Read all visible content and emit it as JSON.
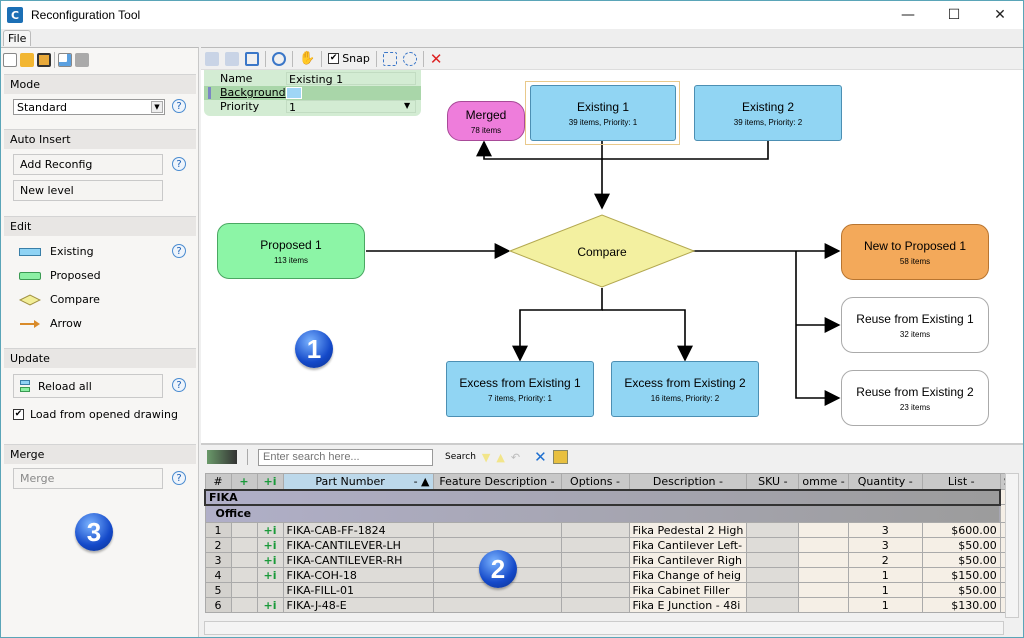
{
  "window": {
    "title": "Reconfiguration Tool",
    "minimize": "—",
    "maximize": "☐",
    "close": "✕"
  },
  "menu": {
    "file": "File"
  },
  "left_panel": {
    "mode": {
      "header": "Mode",
      "selected": "Standard"
    },
    "auto_insert": {
      "header": "Auto Insert",
      "add_reconfig": "Add Reconfig",
      "new_level": "New level"
    },
    "edit": {
      "header": "Edit",
      "tools": [
        {
          "label": "Existing",
          "icon": "existing-shape-icon",
          "color": "#8fd3f4"
        },
        {
          "label": "Proposed",
          "icon": "proposed-shape-icon",
          "color": "#8cf0a4"
        },
        {
          "label": "Compare",
          "icon": "compare-diamond-icon",
          "color": "#f2ee98"
        },
        {
          "label": "Arrow",
          "icon": "arrow-icon",
          "color": "#d98b2a"
        }
      ]
    },
    "update": {
      "header": "Update",
      "reload_all": "Reload all",
      "load_from_drawing": "Load from opened drawing",
      "load_checked": true
    },
    "merge": {
      "header": "Merge",
      "merge_button": "Merge"
    },
    "help": "?",
    "badge": "3"
  },
  "canvas_toolbar": {
    "snap_label": "Snap",
    "snap_checked": true
  },
  "properties": {
    "rows": [
      {
        "label": "Name",
        "value": "Existing 1"
      },
      {
        "label": "Background",
        "value": ""
      },
      {
        "label": "Priority",
        "value": "1"
      }
    ],
    "background_color": "#9fd6f6"
  },
  "diagram": {
    "nodes": {
      "merged": {
        "title": "Merged",
        "sub": "78 items",
        "color": "#ee7ddb"
      },
      "existing1": {
        "title": "Existing 1",
        "sub": "39 items, Priority: 1",
        "color": "#91d5f3"
      },
      "existing2": {
        "title": "Existing 2",
        "sub": "39 items, Priority: 2",
        "color": "#91d5f3"
      },
      "proposed1": {
        "title": "Proposed 1",
        "sub": "113 items",
        "color": "#8cf5a6"
      },
      "compare": {
        "title": "Compare",
        "color": "#f3f0a0"
      },
      "new_to_proposed": {
        "title": "New to Proposed 1",
        "sub": "58 items",
        "color": "#f3a95a"
      },
      "reuse1": {
        "title": "Reuse from Existing 1",
        "sub": "32 items",
        "color": "#ffffff"
      },
      "reuse2": {
        "title": "Reuse from Existing 2",
        "sub": "23 items",
        "color": "#ffffff"
      },
      "excess1": {
        "title": "Excess from Existing 1",
        "sub": "7 items, Priority: 1",
        "color": "#91d5f3"
      },
      "excess2": {
        "title": "Excess from Existing 2",
        "sub": "16 items, Priority: 2",
        "color": "#91d5f3"
      }
    },
    "badge": "1"
  },
  "grid": {
    "search_placeholder": "Enter search here...",
    "search_button": "Search",
    "columns": [
      "#",
      "+",
      "+i",
      "Part Number",
      "Feature Description",
      "Options",
      "Description",
      "SKU",
      "omme",
      "Quantity",
      "List",
      "S"
    ],
    "group": "FIKA",
    "subgroup": "Office",
    "rows": [
      {
        "n": "1",
        "info": true,
        "part": "FIKA-CAB-FF-1824",
        "desc": "Fika Pedestal 2 High",
        "qty": "3",
        "list": "$600.00"
      },
      {
        "n": "2",
        "info": true,
        "part": "FIKA-CANTILEVER-LH",
        "desc": "Fika Cantilever Left-",
        "qty": "3",
        "list": "$50.00"
      },
      {
        "n": "3",
        "info": true,
        "part": "FIKA-CANTILEVER-RH",
        "desc": "Fika Cantilever Righ",
        "qty": "2",
        "list": "$50.00"
      },
      {
        "n": "4",
        "info": true,
        "part": "FIKA-COH-18",
        "desc": "Fika Change of heig",
        "qty": "1",
        "list": "$150.00"
      },
      {
        "n": "5",
        "info": false,
        "part": "FIKA-FILL-01",
        "desc": "Fika Cabinet Filler",
        "qty": "1",
        "list": "$50.00"
      },
      {
        "n": "6",
        "info": true,
        "part": "FIKA-J-48-E",
        "desc": "Fika E Junction - 48i",
        "qty": "1",
        "list": "$130.00"
      }
    ],
    "badge": "2"
  }
}
